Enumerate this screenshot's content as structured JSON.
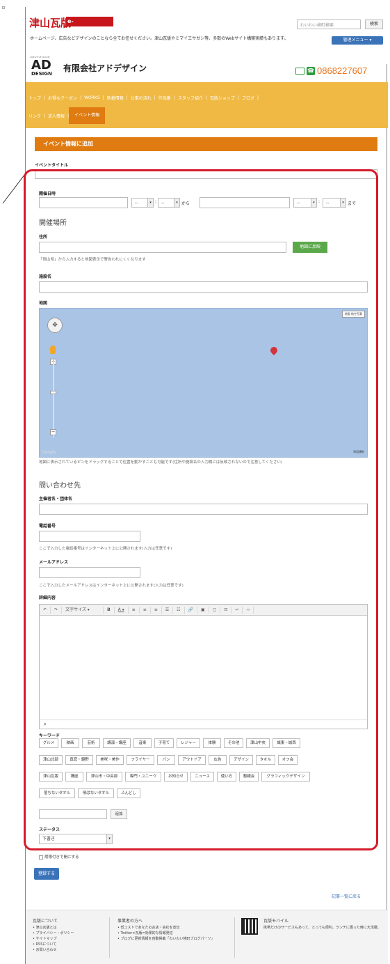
{
  "header": {
    "logo": "津山瓦版",
    "logo_domain": "e-tsuyama.com",
    "search_placeholder": "わいわい検町検索",
    "search_button": "検索",
    "intro": "ホームページ、広告などデザインのことなら全てお任せください。津山瓦版やミマイエサガシ等、多数のWebサイト構築実績もあります。",
    "admin_menu": "管理メニュー ▾",
    "creative_room": "CREATIVE ROOM",
    "ad_logo": "AD",
    "ad_logo_sub": "DESIGN",
    "company": "有限会社アドデザイン",
    "phone": "0868227607"
  },
  "nav": {
    "row1": [
      "トップ",
      "お得なクーポン",
      "WORKS",
      "新着情報",
      "仕事の流れ",
      "作品集",
      "スタッフ紹介",
      "瓦版ショップ",
      "ブログ"
    ],
    "row2": [
      "リンク",
      "求人情報",
      "イベント情報"
    ]
  },
  "form": {
    "section_title": "イベント情報に追加",
    "event_title_label": "イベントタイトル",
    "date_label": "開催日時",
    "date_dash": "--",
    "from": "から",
    "until": "まで",
    "venue_heading": "開催場所",
    "address_label": "住所",
    "map_reflect_button": "地図に反映",
    "address_note": "「岡山県」から入力すると地図表示で警告われにくくなります",
    "facility_label": "施設名",
    "map_label": "地図",
    "map_type": "地図 航空写真",
    "google": "Google",
    "terms": "利用規約",
    "map_note": "地図に表示されているピンをドラッグすることで位置を動かすことも可能です(住所や施設名の入力欄には反映されないので注意してください)",
    "contact_heading": "問い合わせ先",
    "organizer_label": "主催者名・団体名",
    "phone_label": "電話番号",
    "phone_note": "ここで入力した電話番号はインターネット上に公開されます(入力は任意です)",
    "email_label": "メールアドレス",
    "email_note": "ここで入力したメールアドレスはインターネット上に公開されます(入力は任意です)",
    "detail_label": "詳細内容",
    "editor_font_size": "文字サイズ",
    "editor_status": "p",
    "keyword_label": "キーワード",
    "keywords": [
      [
        "グルメ",
        "映画",
        "芸術",
        "講演・講座",
        "音楽",
        "子育て",
        "レジャー",
        "体験",
        "その他",
        "津山中央",
        "城東・城西"
      ],
      [
        "津山北部",
        "真庭・鏡野",
        "美咲・美作",
        "フライヤー",
        "パン",
        "アウトドア",
        "広告",
        "デザイン",
        "タオル",
        "オフ会"
      ],
      [
        "津山瓦版",
        "講座",
        "津山市・中央部",
        "専門・ユニーク",
        "お知らせ",
        "ニュース",
        "使い方",
        "懇親会",
        "グラフィックデザイン"
      ],
      [
        "落ちないタオル",
        "飛ばないタオル",
        "ふんどし"
      ]
    ],
    "add_button": "追加",
    "status_label": "ステータス",
    "status_value": "下書き",
    "private_checkbox": "期限付きで開にする",
    "submit": "登録する",
    "back_link": "記事一覧に戻る"
  },
  "footer": {
    "col1_title": "瓦版について",
    "col1_items": [
      "津山瓦版とは",
      "プライバシー・ポリシー",
      "サイトマップ",
      "RSSについて",
      "お問い合わせ"
    ],
    "col2_title": "事業者の方へ",
    "col2_items": [
      "低コストであなたのお店・会社を宣伝",
      "Twitter×瓦版=効果的な情報発信",
      "ブログに更新情報を自動掲載「わいわい検町ブログパーツ」"
    ],
    "col3_title": "瓦版モバイル",
    "col3_text": "携帯だけのサービスもあって、とっても便利。ランチに困った時に大活躍。"
  },
  "colors": {
    "accent": "#e07b11",
    "nav": "#efb944",
    "brand": "#c8161d",
    "highlight": "#d51b2a",
    "blue": "#3b73b9",
    "green": "#5aa84a"
  }
}
